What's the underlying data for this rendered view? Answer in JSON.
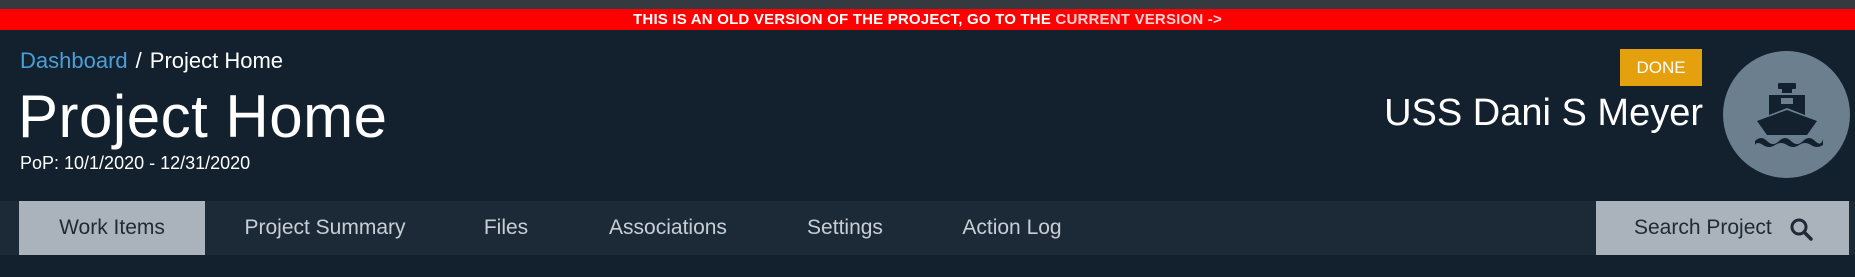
{
  "banner": {
    "message": "THIS IS AN OLD VERSION OF THE PROJECT, GO TO THE ",
    "link_label": "CURRENT VERSION ->",
    "color": "#ff0000"
  },
  "breadcrumb": {
    "items": [
      {
        "label": "Dashboard"
      },
      {
        "label": "Project Home"
      }
    ],
    "separator": "/"
  },
  "header": {
    "title": "Project Home",
    "pop": "PoP: 10/1/2020 - 12/31/2020",
    "status_badge": "DONE",
    "status_color": "#e5a00d",
    "ship_name": "USS Dani S Meyer",
    "avatar_icon": "ship-icon"
  },
  "nav": {
    "tabs": [
      {
        "label": "Work Items",
        "active": true
      },
      {
        "label": "Project Summary",
        "active": false
      },
      {
        "label": "Files",
        "active": false
      },
      {
        "label": "Associations",
        "active": false
      },
      {
        "label": "Settings",
        "active": false
      },
      {
        "label": "Action Log",
        "active": false
      }
    ],
    "search_label": "Search Project",
    "search_icon": "search-icon"
  }
}
